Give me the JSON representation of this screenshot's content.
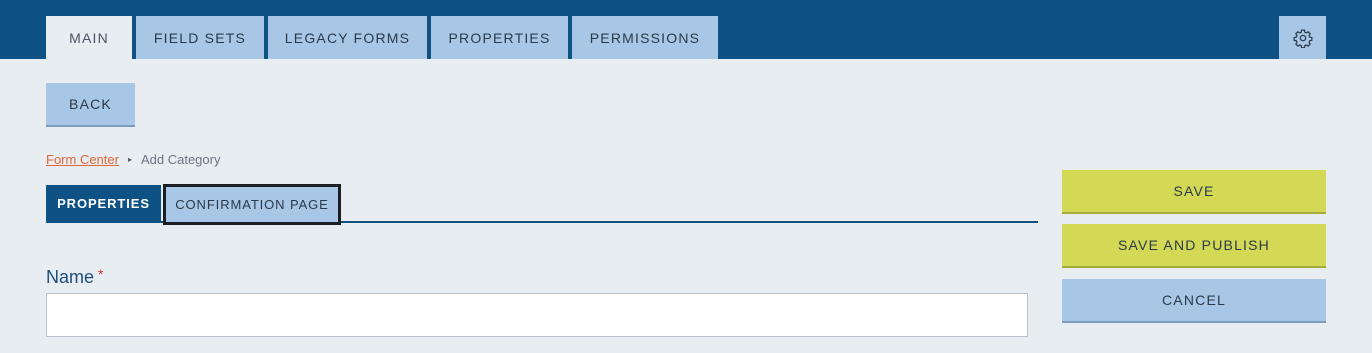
{
  "top_tabs": [
    {
      "label": "MAIN",
      "active": true
    },
    {
      "label": "FIELD SETS",
      "active": false
    },
    {
      "label": "LEGACY FORMS",
      "active": false
    },
    {
      "label": "PROPERTIES",
      "active": false
    },
    {
      "label": "PERMISSIONS",
      "active": false
    }
  ],
  "settings": {
    "icon": "gear-icon"
  },
  "back_button": {
    "label": "BACK"
  },
  "breadcrumb": {
    "link": "Form Center",
    "separator_icon": "triangle-right-icon",
    "separator": "▸",
    "current": "Add Category"
  },
  "sub_tabs": [
    {
      "label": "PROPERTIES",
      "active": true
    },
    {
      "label": "CONFIRMATION PAGE",
      "active": false,
      "focused": true
    }
  ],
  "form": {
    "name_label": "Name",
    "required_marker": "*",
    "name_value": "",
    "name_placeholder": ""
  },
  "actions": {
    "save": "SAVE",
    "save_publish": "SAVE AND PUBLISH",
    "cancel": "CANCEL"
  },
  "colors": {
    "header": "#0d5185",
    "tab": "#a8c6e5",
    "background": "#e8edf2",
    "lime_button": "#d3d955",
    "link": "#e0673a",
    "required": "#d0312d"
  }
}
